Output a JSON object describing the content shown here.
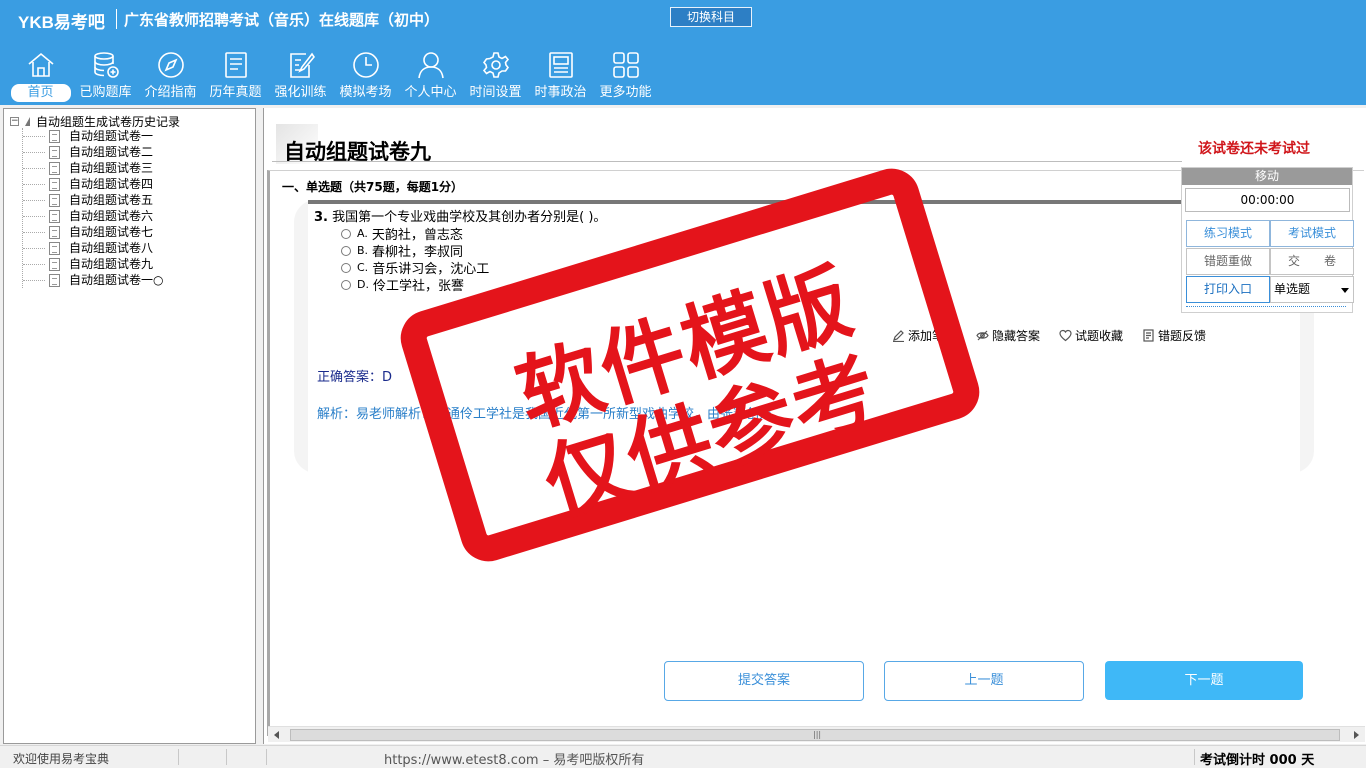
{
  "header": {
    "logo": "YKB易考吧",
    "title": "广东省教师招聘考试（音乐）在线题库（初中）",
    "switch_subject": "切换科目"
  },
  "nav": [
    {
      "label": "首页",
      "icon": "home-icon"
    },
    {
      "label": "已购题库",
      "icon": "database-icon"
    },
    {
      "label": "介绍指南",
      "icon": "compass-icon"
    },
    {
      "label": "历年真题",
      "icon": "document-list-icon"
    },
    {
      "label": "强化训练",
      "icon": "edit-icon"
    },
    {
      "label": "模拟考场",
      "icon": "clock-icon"
    },
    {
      "label": "个人中心",
      "icon": "user-icon"
    },
    {
      "label": "时间设置",
      "icon": "gear-icon"
    },
    {
      "label": "时事政治",
      "icon": "newspaper-icon"
    },
    {
      "label": "更多功能",
      "icon": "grid-icon"
    }
  ],
  "tree": {
    "root": "自动组题生成试卷历史记录",
    "items": [
      "自动组题试卷一",
      "自动组题试卷二",
      "自动组题试卷三",
      "自动组题试卷四",
      "自动组题试卷五",
      "自动组题试卷六",
      "自动组题试卷七",
      "自动组题试卷八",
      "自动组题试卷九",
      "自动组题试卷一○"
    ]
  },
  "paper": {
    "title": "自动组题试卷九",
    "status": "该试卷还未考试过",
    "section": "一、单选题（共75题，每题1分）"
  },
  "question": {
    "number": "3.",
    "text": "我国第一个专业戏曲学校及其创办者分别是(  )。",
    "options": [
      {
        "letter": "A.",
        "text": "天韵社，曾志忞"
      },
      {
        "letter": "B.",
        "text": "春柳社，李叔同"
      },
      {
        "letter": "C.",
        "text": "音乐讲习会，沈心工"
      },
      {
        "letter": "D.",
        "text": "伶工学社，张謇"
      }
    ],
    "tools": {
      "add_note": "添加笔记",
      "hide_answer": "隐藏答案",
      "favorite": "试题收藏",
      "report_error": "错题反馈"
    },
    "answer": "正确答案：D",
    "analysis": "解析：易老师解析：南通伶工学社是我国近代第一所新型戏曲学校，由张謇创办。"
  },
  "float_panel": {
    "move": "移动",
    "timer": "00:00:00",
    "practice_mode": "练习模式",
    "exam_mode": "考试模式",
    "redo_wrong": "错题重做",
    "submit_paper": "交　　卷",
    "print": "打印入口",
    "question_type": "单选题"
  },
  "buttons": {
    "submit_answer": "提交答案",
    "prev": "上一题",
    "next": "下一题"
  },
  "watermark": {
    "line1": "软件模版",
    "line2": "仅供参考"
  },
  "statusbar": {
    "welcome": "欢迎使用易考宝典",
    "copyright": "https://www.etest8.com – 易考吧版权所有",
    "countdown": "考试倒计时 000 天"
  }
}
